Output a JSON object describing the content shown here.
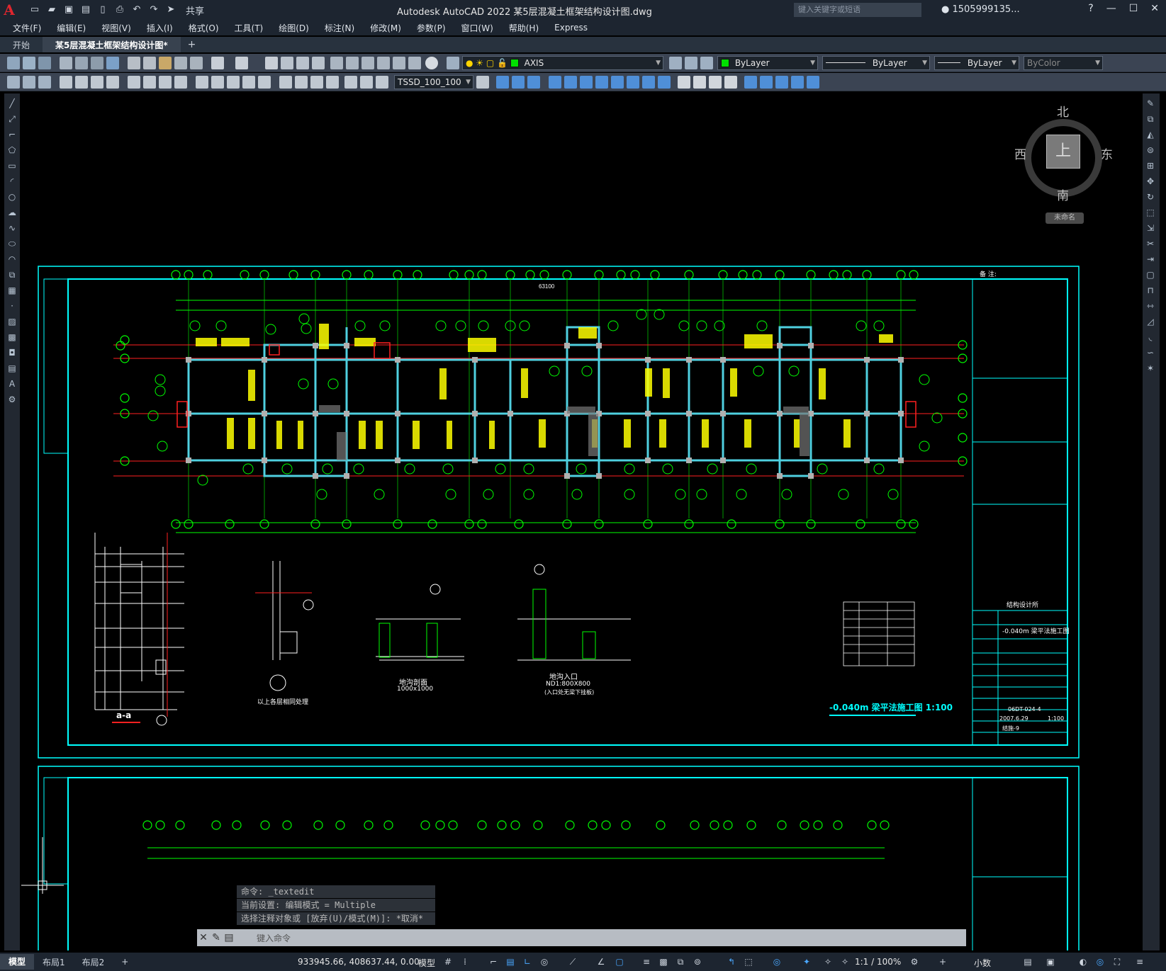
{
  "app": {
    "logo_letter": "A",
    "title": "Autodesk AutoCAD 2022    某5层混凝土框架结构设计图.dwg",
    "search_placeholder": "键入关键字或短语",
    "user": "1505999135...",
    "share": "共享"
  },
  "menu": [
    "文件(F)",
    "编辑(E)",
    "视图(V)",
    "插入(I)",
    "格式(O)",
    "工具(T)",
    "绘图(D)",
    "标注(N)",
    "修改(M)",
    "参数(P)",
    "窗口(W)",
    "帮助(H)",
    "Express"
  ],
  "tabs": [
    {
      "label": "开始"
    },
    {
      "label": "某5层混凝土框架结构设计图*"
    },
    {
      "label": "+"
    }
  ],
  "toolbar": {
    "layer": "AXIS",
    "color": "ByLayer",
    "linetype": "ByLayer",
    "lineweight": "ByLayer",
    "plotstyle": "ByColor",
    "dimstyle": "TSSD_100_100"
  },
  "viewcube": {
    "north": "北",
    "south": "南",
    "east": "东",
    "west": "西",
    "face": "上",
    "wcs": "未命名"
  },
  "drawing": {
    "main_title": "-0.040m 梁平法施工图 1:100",
    "section_label": "a-a",
    "detail_note": "以上各层相同处理",
    "trench_1": "地沟剖面",
    "trench_1_size": "1000x1000",
    "trench_2": "地沟入口",
    "trench_2_size": "ND1:800X800",
    "trench_2_note": "(入口处无梁下挂板)",
    "top_total": "63100",
    "title_block": {
      "notes_head": "备 注:",
      "designer": "结构设计所",
      "drawing_name": "-0.040m 梁平法施工图",
      "number": "06DT-024-4",
      "date": "2007.6.29",
      "scale": "1:100",
      "sheet": "结施-9"
    }
  },
  "command": {
    "lines": [
      "命令: _textedit",
      "当前设置: 编辑模式 = Multiple",
      "选择注释对象或 [放弃(U)/模式(M)]: *取消*"
    ],
    "placeholder": "键入命令"
  },
  "status": {
    "layouts": [
      "模型",
      "布局1",
      "布局2",
      "+"
    ],
    "coords": "933945.66, 408637.44, 0.00",
    "mode": "模型",
    "scale": "1:1 / 100%",
    "units": "小数"
  }
}
